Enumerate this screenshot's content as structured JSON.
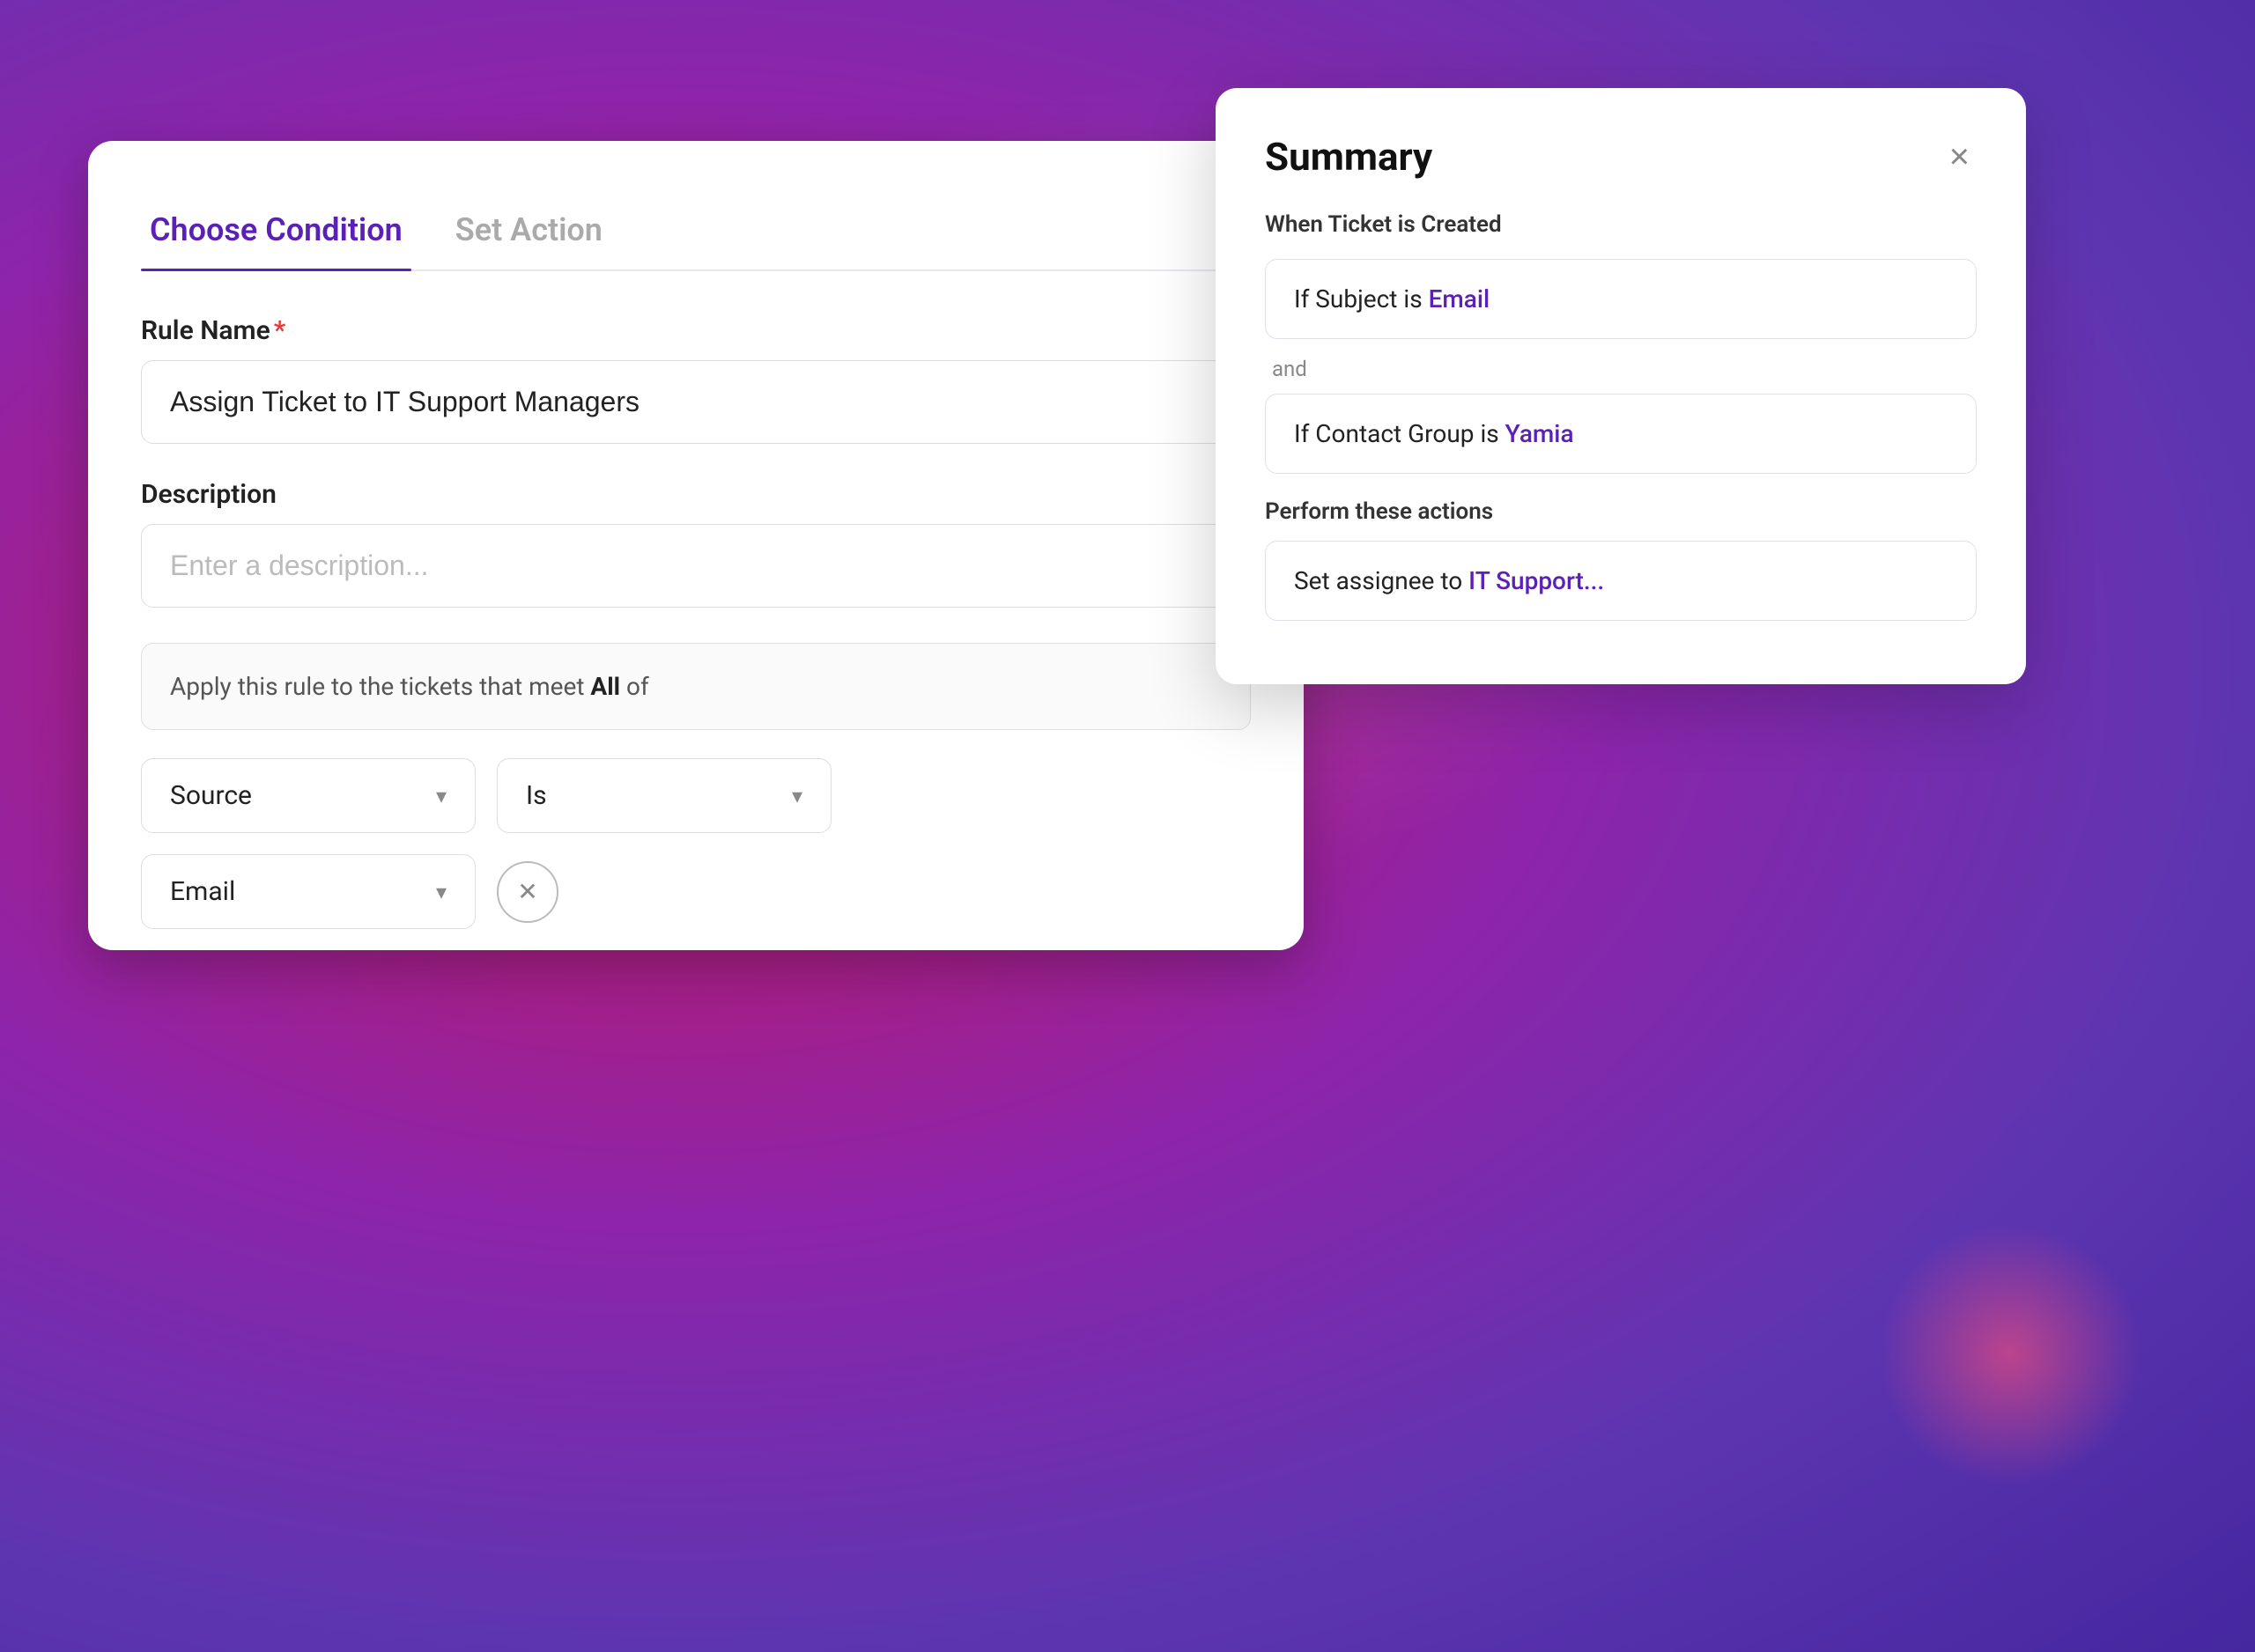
{
  "background": {
    "alt": "purple-pink gradient background"
  },
  "main_card": {
    "tabs": [
      {
        "id": "choose-condition",
        "label": "Choose  Condition",
        "active": true
      },
      {
        "id": "set-action",
        "label": "Set Action",
        "active": false
      }
    ],
    "rule_name_label": "Rule Name",
    "rule_name_required": "*",
    "rule_name_value": "Assign Ticket to IT Support Managers",
    "description_label": "Description",
    "description_placeholder": "Enter a description...",
    "apply_rule_prefix": "Apply this rule to the tickets that meet ",
    "apply_rule_bold": "All",
    "apply_rule_suffix": " of",
    "condition_row1": {
      "dropdown1_label": "Source",
      "dropdown1_arrow": "▾",
      "dropdown2_label": "Is",
      "dropdown2_arrow": "▾"
    },
    "condition_row2": {
      "dropdown_label": "Email",
      "dropdown_arrow": "▾",
      "remove_icon": "✕"
    }
  },
  "summary_panel": {
    "title": "Summary",
    "close_icon": "×",
    "trigger_text": "When Ticket is Created",
    "conditions": [
      {
        "text_prefix": "If Subject is ",
        "text_accent": "Email",
        "connector": "and"
      },
      {
        "text_prefix": "If Contact Group is ",
        "text_accent": "Yamia",
        "connector": null
      }
    ],
    "actions_label": "Perform these actions",
    "actions": [
      {
        "text_prefix": "Set assignee to ",
        "text_accent": "IT Support..."
      }
    ]
  }
}
